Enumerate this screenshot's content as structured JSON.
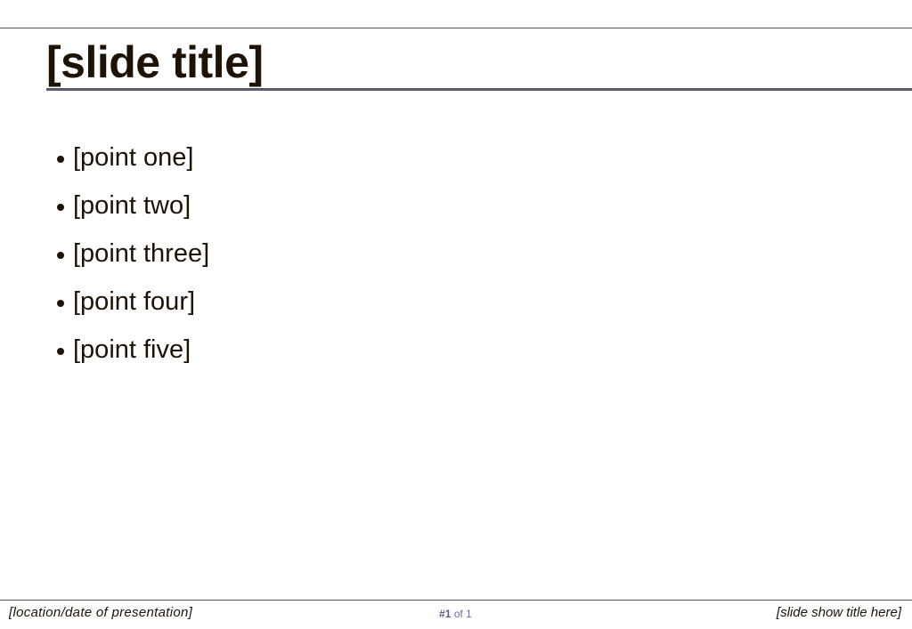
{
  "slide": {
    "title": "[slide title]",
    "points": [
      "[point one]",
      "[point two]",
      "[point three]",
      "[point four]",
      "[point five]"
    ]
  },
  "footer": {
    "location_date": "[location/date of presentation]",
    "slide_number_prefix": "#",
    "slide_number": "1",
    "slide_total_text": "of 1",
    "slideshow_title": "[slide show title here]"
  },
  "colors": {
    "text": "#1e1205",
    "title_underline": "#5a5a6a",
    "page_counter": "#6a6aa0"
  }
}
